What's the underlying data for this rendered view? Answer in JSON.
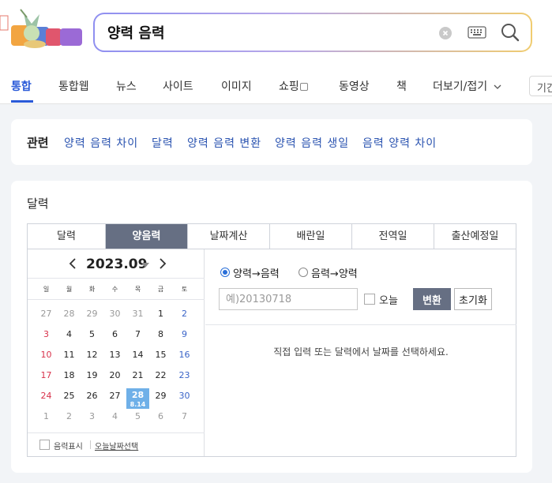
{
  "search": {
    "query": "양력 음력"
  },
  "tabs": [
    {
      "label": "통합",
      "active": true
    },
    {
      "label": "통합웹"
    },
    {
      "label": "뉴스"
    },
    {
      "label": "사이트"
    },
    {
      "label": "이미지"
    },
    {
      "label": "쇼핑"
    },
    {
      "label": "동영상"
    },
    {
      "label": "책"
    },
    {
      "label": "더보기/접기"
    }
  ],
  "tab_extra": "기간",
  "related": {
    "title": "관련",
    "links": [
      "양력 음력 차이",
      "달력",
      "양력 음력 변환",
      "양력 음력 생일",
      "음력 양력 차이"
    ]
  },
  "calendar_widget": {
    "title": "달력",
    "tabs": [
      "달력",
      "양음력",
      "날짜계산",
      "배란일",
      "전역일",
      "출산예정일"
    ],
    "active_tab": 1,
    "month_label": "2023.09",
    "weekdays": [
      "일",
      "월",
      "화",
      "수",
      "목",
      "금",
      "토"
    ],
    "weeks": [
      [
        "27",
        "28",
        "29",
        "30",
        "31",
        "1",
        "2"
      ],
      [
        "3",
        "4",
        "5",
        "6",
        "7",
        "8",
        "9"
      ],
      [
        "10",
        "11",
        "12",
        "13",
        "14",
        "15",
        "16"
      ],
      [
        "17",
        "18",
        "19",
        "20",
        "21",
        "22",
        "23"
      ],
      [
        "24",
        "25",
        "26",
        "27",
        "28",
        "29",
        "30"
      ],
      [
        "1",
        "2",
        "3",
        "4",
        "5",
        "6",
        "7"
      ]
    ],
    "selected_sub": "8.14",
    "footer_check_label": "음력표시",
    "footer_link": "오늘날짜선택",
    "radio_solar_to_lunar": "양력→음력",
    "radio_lunar_to_solar": "음력→양력",
    "date_placeholder": "예)20130718",
    "today_label": "오늘",
    "convert_label": "변환",
    "reset_label": "초기화",
    "instruction": "직접 입력 또는 달력에서 날짜를 선택하세요."
  },
  "colors": {
    "accent": "#2a5ad8",
    "active_tab_bg": "#666f83",
    "selected_day": "#6fb0e8",
    "sunday": "#d8314a",
    "saturday": "#3a64c8"
  }
}
